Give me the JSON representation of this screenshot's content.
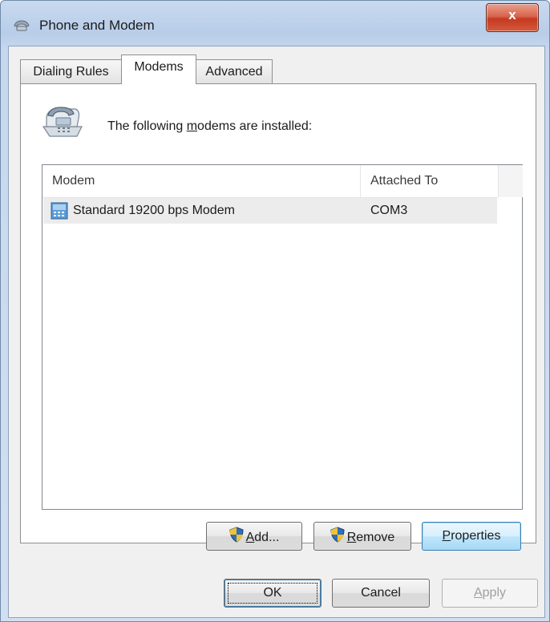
{
  "window": {
    "title": "Phone and Modem",
    "close_glyph": "x",
    "icon": "phone-modem-icon"
  },
  "tabs": [
    {
      "label": "Dialing Rules",
      "active": false
    },
    {
      "label": "Modems",
      "active": true
    },
    {
      "label": "Advanced",
      "active": false
    }
  ],
  "modems_tab": {
    "intro_before": "The following ",
    "intro_accel": "m",
    "intro_after": "odems are installed:",
    "columns": [
      "Modem",
      "Attached To"
    ],
    "rows": [
      {
        "modem": "Standard 19200 bps Modem",
        "attached_to": "COM3",
        "selected": true
      }
    ],
    "buttons": {
      "add": {
        "accel": "A",
        "rest": "dd..."
      },
      "remove": {
        "accel": "R",
        "rest": "emove"
      },
      "properties": {
        "accel": "P",
        "rest": "roperties"
      }
    }
  },
  "dialog_buttons": {
    "ok": "OK",
    "cancel": "Cancel",
    "apply_accel": "A",
    "apply_rest": "pply"
  },
  "colors": {
    "close_button": "#c43a20",
    "selected_row": "#ececec",
    "focus_border": "#3c7fb1"
  }
}
